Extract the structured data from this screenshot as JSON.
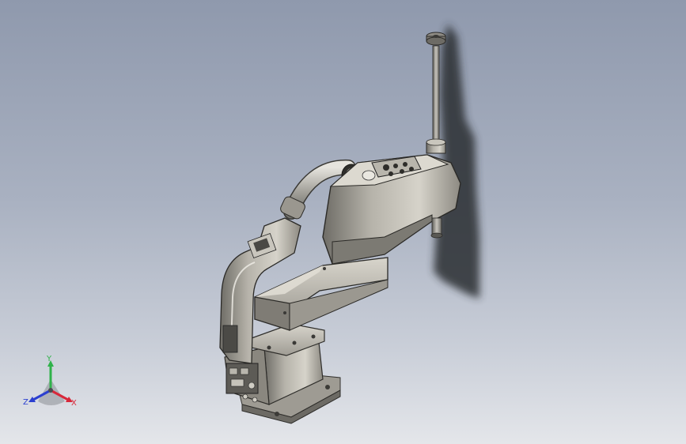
{
  "viewport": {
    "background_top": "#8f99ad",
    "background_bottom": "#e4e6ea",
    "model_name": "scara-robot"
  },
  "triad": {
    "x_label": "X",
    "y_label": "Y",
    "z_label": "Z",
    "x_color": "#d8283a",
    "y_color": "#2fb24a",
    "z_color": "#2b3fd0"
  }
}
